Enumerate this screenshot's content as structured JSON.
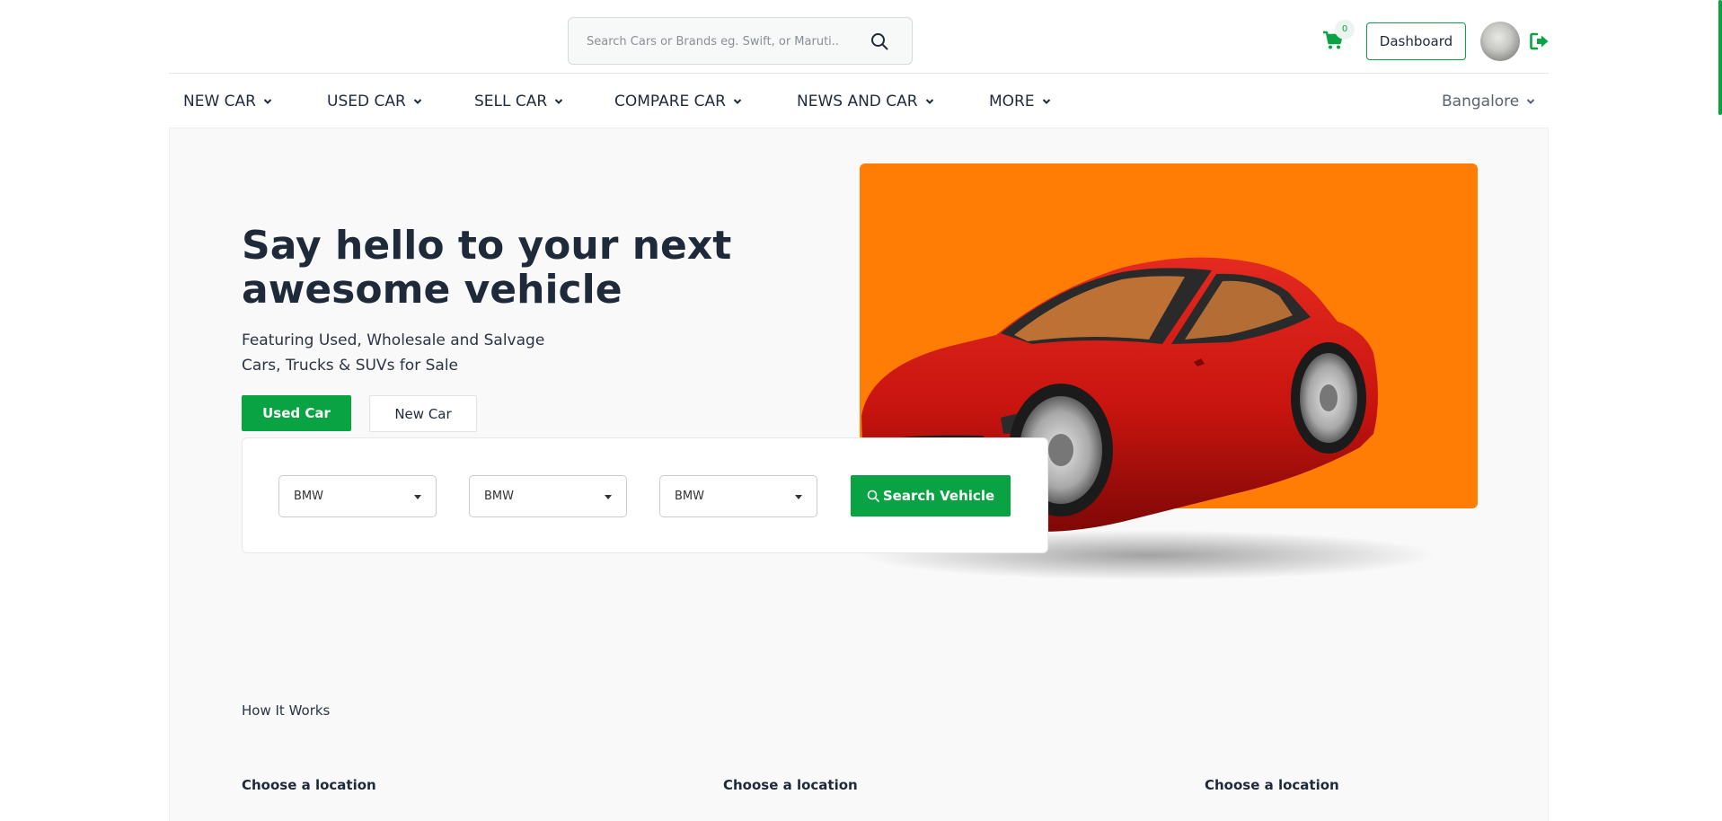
{
  "header": {
    "search_placeholder": "Search Cars or Brands eg. Swift, or Maruti..",
    "cart_count": "0",
    "dashboard_label": "Dashboard"
  },
  "nav": {
    "items": [
      {
        "label": "NEW CAR"
      },
      {
        "label": "USED CAR"
      },
      {
        "label": "SELL CAR"
      },
      {
        "label": "COMPARE CAR"
      },
      {
        "label": "NEWS AND CAR"
      },
      {
        "label": "MORE"
      }
    ],
    "city": "Bangalore"
  },
  "hero": {
    "title": "Say hello to your next awesome vehicle",
    "subtitle_line1": "Featuring Used, Wholesale and Salvage",
    "subtitle_line2": "Cars, Trucks & SUVs for Sale",
    "btn_used": "Used Car",
    "btn_new": "New Car"
  },
  "search_form": {
    "selects": [
      "BMW",
      "BMW",
      "BMW"
    ],
    "button": "Search Vehicle"
  },
  "how_it_works": {
    "heading": "How It Works",
    "steps": [
      "Choose a location",
      "Choose a location",
      "Choose a location"
    ]
  },
  "colors": {
    "accent": "#0aa343",
    "hero_panel": "#ff7d05",
    "car": "#c8140f"
  },
  "icons": [
    "search-icon",
    "cart-icon",
    "logout-icon",
    "chevron-down-icon"
  ]
}
